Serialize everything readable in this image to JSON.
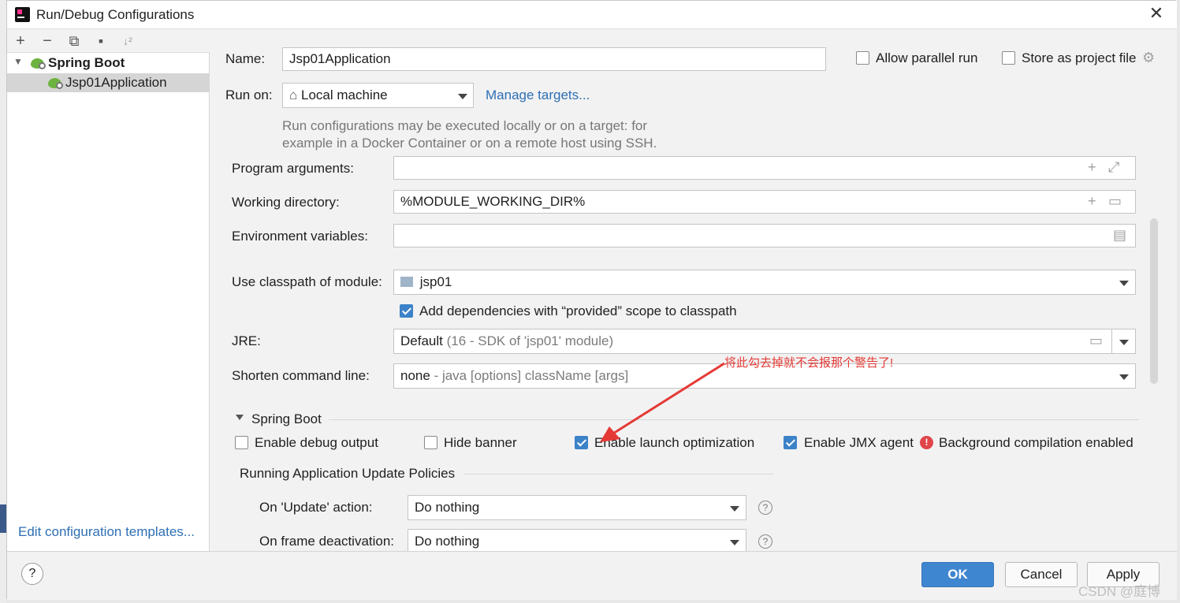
{
  "window": {
    "title": "Run/Debug Configurations",
    "close_glyph": "✕"
  },
  "toolbar": {
    "add": "+",
    "remove": "−",
    "copy": "⧉",
    "folder": "▪",
    "sort": "↓²"
  },
  "tree": {
    "group_label": "Spring Boot",
    "item_label": "Jsp01Application"
  },
  "left_footer": {
    "edit_templates": "Edit configuration templates..."
  },
  "form": {
    "name_label": "Name:",
    "name_value": "Jsp01Application",
    "allow_parallel_label": "Allow parallel run",
    "store_project_label": "Store as project file",
    "run_on_label": "Run on:",
    "run_on_value": "Local machine",
    "manage_targets": "Manage targets...",
    "hint_line1": "Run configurations may be executed locally or on a target: for",
    "hint_line2": "example in a Docker Container or on a remote host using SSH.",
    "program_args_label": "Program arguments:",
    "program_args_value": "",
    "working_dir_label": "Working directory:",
    "working_dir_value": "%MODULE_WORKING_DIR%",
    "env_vars_label": "Environment variables:",
    "env_vars_value": "",
    "classpath_label": "Use classpath of module:",
    "classpath_value": "jsp01",
    "add_deps_label": "Add dependencies with “provided” scope to classpath",
    "jre_label": "JRE:",
    "jre_value": "Default",
    "jre_detail": "(16 - SDK of 'jsp01' module)",
    "shorten_label": "Shorten command line:",
    "shorten_value": "none",
    "shorten_detail": "- java [options] className [args]"
  },
  "spring_boot": {
    "section_title": "Spring Boot",
    "debug_output": "Enable debug output",
    "hide_banner": "Hide banner",
    "launch_opt": "Enable launch optimization",
    "jmx_agent": "Enable JMX agent",
    "bg_compile": "Background compilation enabled",
    "policies_title": "Running Application Update Policies",
    "update_action_label": "On 'Update' action:",
    "update_action_value": "Do nothing",
    "frame_deact_label": "On frame deactivation:",
    "frame_deact_value": "Do nothing"
  },
  "annotation": {
    "text": "将此勾去掉就不会报那个警告了!"
  },
  "buttons": {
    "help": "?",
    "ok": "OK",
    "cancel": "Cancel",
    "apply": "Apply"
  },
  "watermark": "CSDN @庭博",
  "colors": {
    "accent": "#3f86d0",
    "link": "#2e6fb4",
    "annotation": "#e53935"
  }
}
